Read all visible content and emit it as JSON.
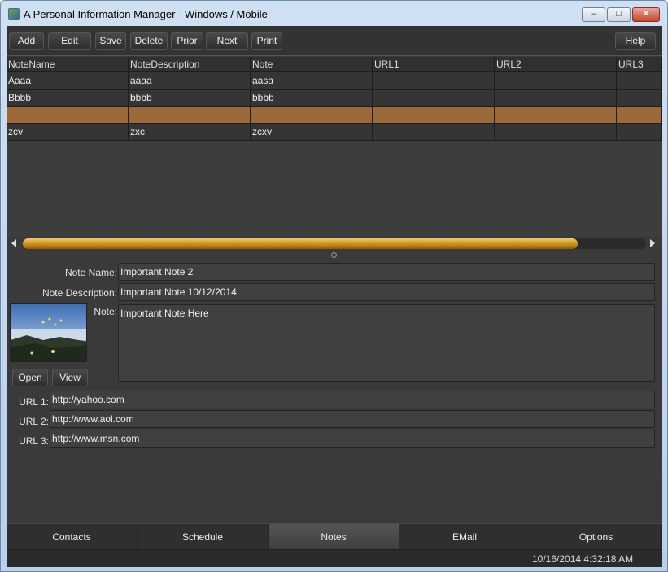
{
  "window": {
    "title": "A Personal Information Manager - Windows / Mobile",
    "controls": {
      "minimize": "–",
      "maximize": "□",
      "close": "✕"
    }
  },
  "toolbar": {
    "add": "Add",
    "edit": "Edit",
    "save": "Save",
    "delete": "Delete",
    "prior": "Prior",
    "next": "Next",
    "print": "Print",
    "help": "Help"
  },
  "grid": {
    "columns": [
      "NoteName",
      "NoteDescription",
      "Note",
      "URL1",
      "URL2",
      "URL3"
    ],
    "rows": [
      [
        "Aaaa",
        "aaaa",
        "aasa",
        "",
        "",
        ""
      ],
      [
        "Bbbb",
        "bbbb",
        "bbbb",
        "",
        "",
        ""
      ],
      [
        "",
        "",
        "",
        "",
        "",
        ""
      ],
      [
        "zcv",
        "zxc",
        "zcxv",
        "",
        "",
        ""
      ]
    ],
    "selected_row_index": 2,
    "selected_row_color": "#9a6a3a"
  },
  "scrollbar": {
    "position_fraction": 0.89,
    "thumb_color": "#c48b16"
  },
  "form": {
    "note_name_label": "Note Name:",
    "note_name_value": "Important Note 2",
    "note_description_label": "Note Description:",
    "note_description_value": "Important Note 10/12/2014",
    "note_label": "Note:",
    "note_value": "Important Note Here",
    "open_button": "Open",
    "view_button": "View",
    "url1_label": "URL 1:",
    "url1_value": "http://yahoo.com",
    "url2_label": "URL 2:",
    "url2_value": "http://www.aol.com",
    "url3_label": "URL 3:",
    "url3_value": "http://www.msn.com"
  },
  "tabs": [
    {
      "label": "Contacts",
      "active": false
    },
    {
      "label": "Schedule",
      "active": false
    },
    {
      "label": "Notes",
      "active": true
    },
    {
      "label": "EMail",
      "active": false
    },
    {
      "label": "Options",
      "active": false
    }
  ],
  "status": {
    "datetime": "10/16/2014 4:32:18 AM"
  }
}
